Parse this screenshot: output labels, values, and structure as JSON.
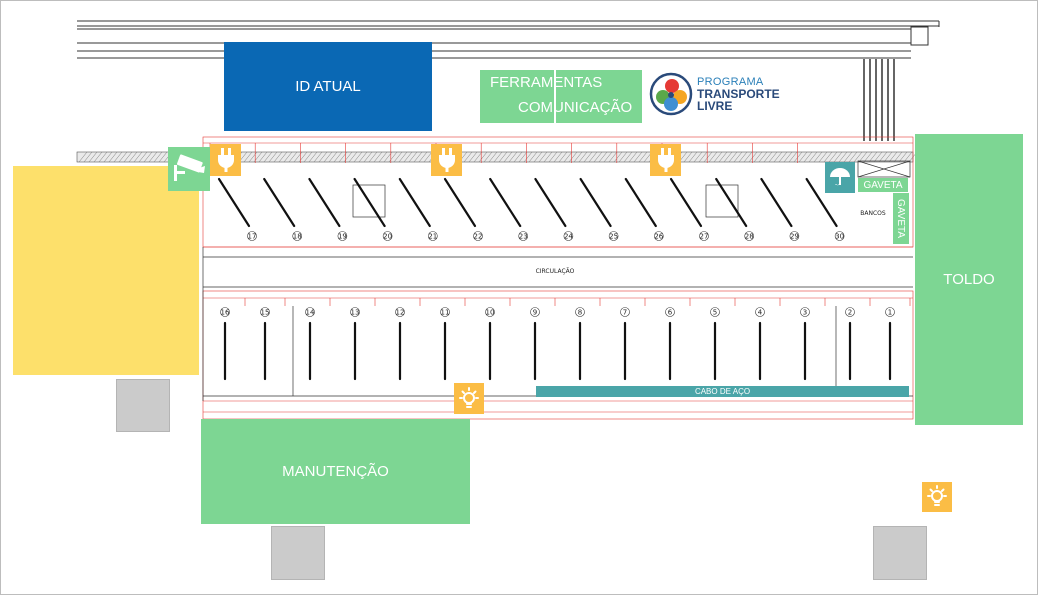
{
  "colors": {
    "green": "#7dd693",
    "blue": "#0a68b4",
    "yellow": "#fde06b",
    "orange": "#fbbd45",
    "teal": "#4aa5a8",
    "grey": "#cbcbcb",
    "red_line": "#e53935"
  },
  "zones": {
    "id_atual": "ID ATUAL",
    "ferramentas": "FERRAMENTAS",
    "comunicacao": "COMUNICAÇÃO",
    "toldo": "TOLDO",
    "manutencao": "MANUTENÇÃO",
    "gaveta_top": "GAVETA",
    "gaveta_side": "GAVETA",
    "cabo_de_aco": "CABO DE AÇO"
  },
  "logo": {
    "line1": "PROGRAMA",
    "line2": "TRANSPORTE",
    "line3": "LIVRE"
  },
  "plan": {
    "circulacao": "CIRCULAÇÃO",
    "bancos": "BANCOS"
  },
  "spots_top": [
    "17",
    "18",
    "19",
    "20",
    "21",
    "22",
    "23",
    "24",
    "25",
    "26",
    "27",
    "28",
    "29",
    "30"
  ],
  "spots_bottom": [
    "16",
    "15",
    "14",
    "13",
    "12",
    "11",
    "10",
    "9",
    "8",
    "7",
    "6",
    "5",
    "4",
    "3",
    "2",
    "1"
  ],
  "icons": [
    "camera-icon",
    "plug-icon",
    "umbrella-icon",
    "lightbulb-icon"
  ]
}
